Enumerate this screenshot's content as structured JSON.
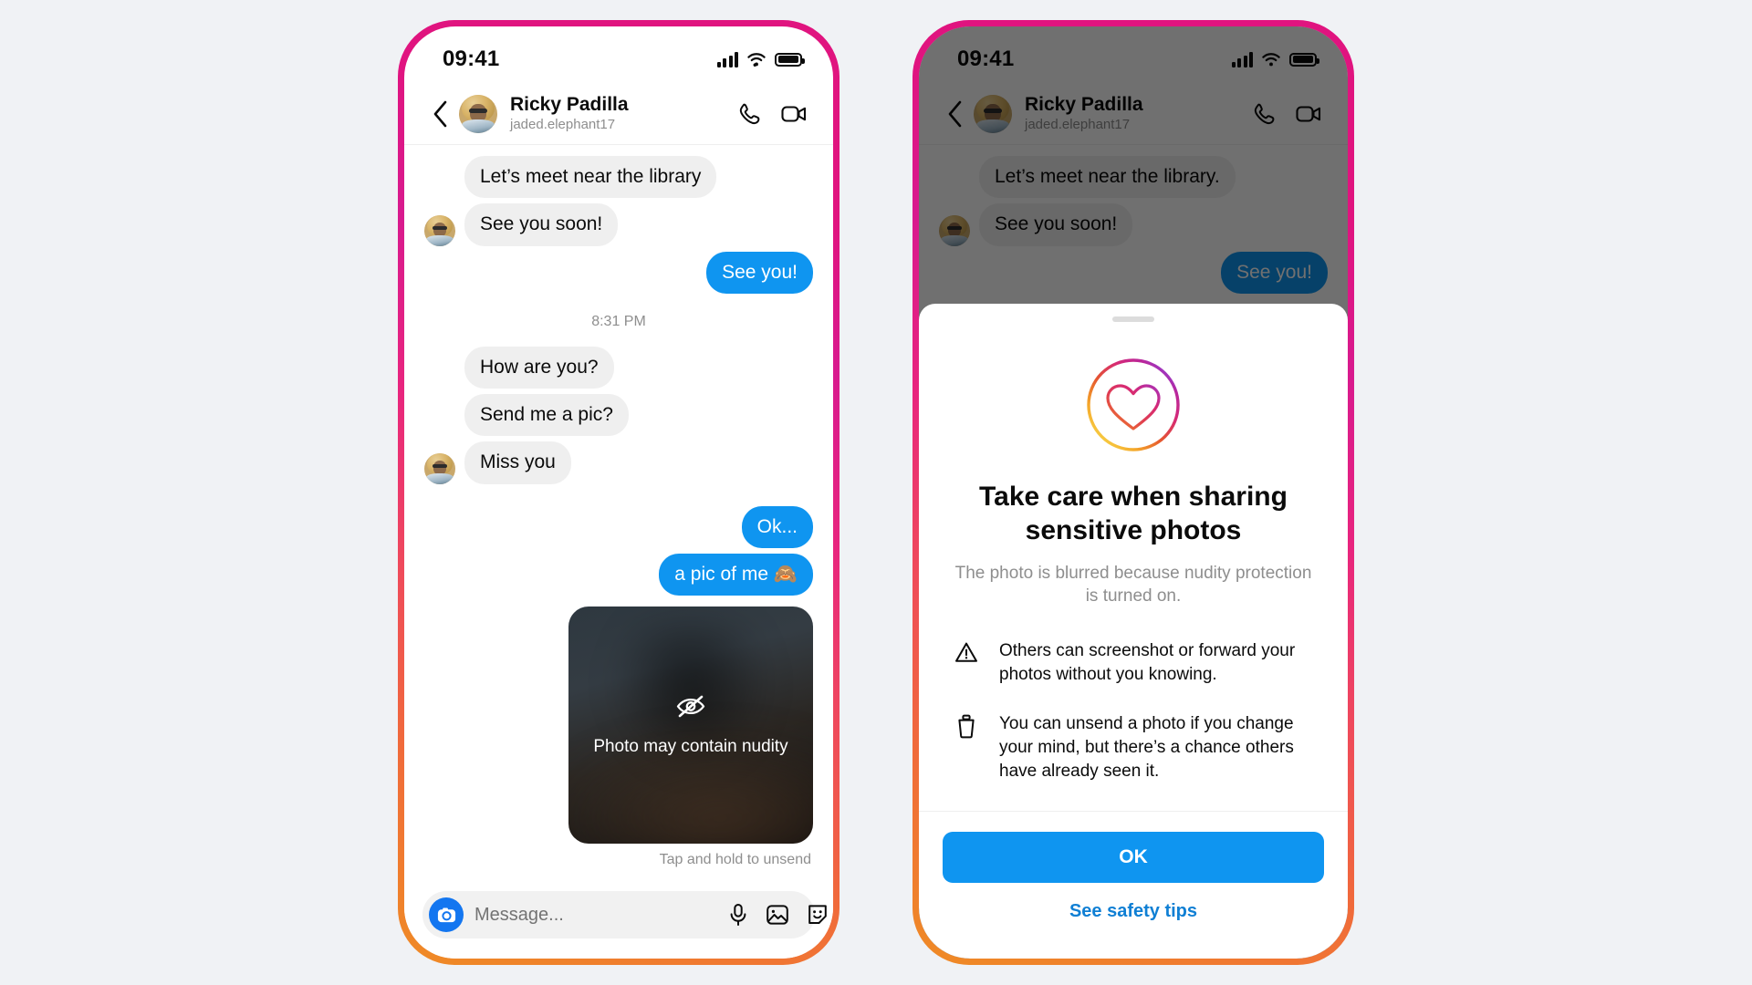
{
  "theme": {
    "accent_blue": "#0f95f0",
    "link_blue": "#0f7fd4",
    "bubble_gray": "#efefef",
    "muted_text": "#8e8e8e",
    "page_background": "#f0f2f5",
    "phone_border_gradient_from": "#e0147f",
    "phone_border_gradient_to": "#ef8b25"
  },
  "status_bar": {
    "time": "09:41",
    "signal_icon": "signal-bars-icon",
    "wifi_icon": "wifi-icon",
    "battery_icon": "battery-icon"
  },
  "chat_header": {
    "back_icon": "chevron-left-icon",
    "avatar": "contact-avatar",
    "name": "Ricky Padilla",
    "handle": "jaded.elephant17",
    "call_icon": "phone-call-icon",
    "video_icon": "video-camera-icon"
  },
  "left_phone": {
    "messages": [
      {
        "id": "m1",
        "from": "them",
        "text": "Let’s meet near the library",
        "show_avatar": false
      },
      {
        "id": "m2",
        "from": "them",
        "text": "See you soon!",
        "show_avatar": true
      },
      {
        "id": "m3",
        "from": "me",
        "text": "See you!"
      }
    ],
    "timestamp": "8:31 PM",
    "messages2": [
      {
        "id": "m4",
        "from": "them",
        "text": "How are you?",
        "show_avatar": false
      },
      {
        "id": "m5",
        "from": "them",
        "text": "Send me a pic?",
        "show_avatar": false
      },
      {
        "id": "m6",
        "from": "them",
        "text": "Miss you",
        "show_avatar": true
      },
      {
        "id": "m7",
        "from": "me",
        "text": "Ok..."
      },
      {
        "id": "m8",
        "from": "me",
        "text": "a pic of me 🙈"
      }
    ],
    "photo_attachment": {
      "icon": "eye-off-icon",
      "label": "Photo may contain nudity",
      "hint": "Tap and hold to unsend"
    },
    "composer": {
      "camera_icon": "camera-icon",
      "placeholder": "Message...",
      "value": "",
      "mic_icon": "microphone-icon",
      "gallery_icon": "photo-gallery-icon",
      "sticker_icon": "sticker-icon"
    }
  },
  "right_phone": {
    "messages": [
      {
        "id": "r1",
        "from": "them",
        "text": "Let’s meet near the library.",
        "show_avatar": false
      },
      {
        "id": "r2",
        "from": "them",
        "text": "See you soon!",
        "show_avatar": true
      },
      {
        "id": "r3",
        "from": "me",
        "text": "See you!"
      }
    ],
    "sheet": {
      "handle": "sheet-drag-handle",
      "icon": "gradient-heart-circle-icon",
      "title": "Take care when sharing sensitive photos",
      "subtitle": "The photo is blurred because nudity protection is turned on.",
      "bullets": [
        {
          "icon": "warning-triangle-icon",
          "text": "Others can screenshot or forward your photos without you knowing."
        },
        {
          "icon": "trash-can-icon",
          "text": "You can unsend a photo if you change your mind, but there’s a chance others have already seen it."
        }
      ],
      "primary_button": "OK",
      "secondary_link": "See safety tips"
    }
  }
}
